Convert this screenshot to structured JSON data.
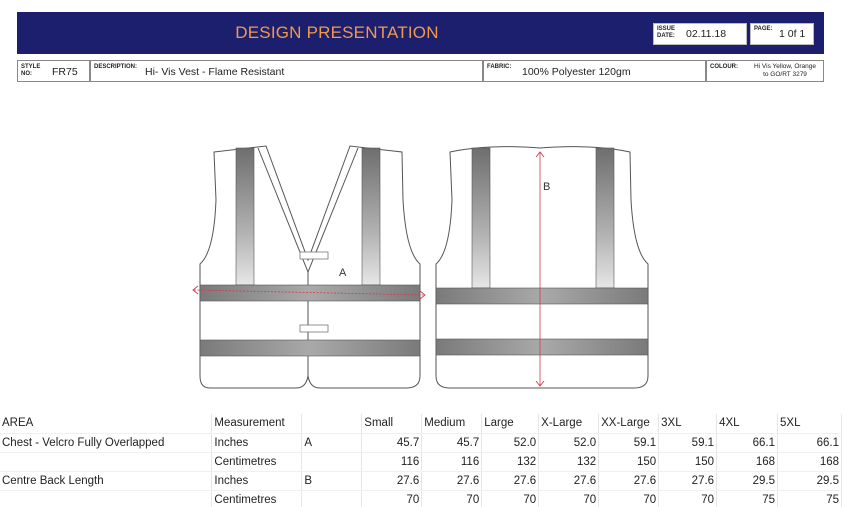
{
  "header": {
    "title": "DESIGN PRESENTATION",
    "issue_label": "ISSUE DATE:",
    "issue_date": "02.11.18",
    "page_label": "PAGE:",
    "page_value": "1 0f 1"
  },
  "info": {
    "style_label": "STYLE NO:",
    "style_value": "FR75",
    "description_label": "DESCRIPTION:",
    "description_value": "Hi- Vis Vest - Flame Resistant",
    "fabric_label": "FABRIC:",
    "fabric_value": "100% Polyester 120gm",
    "colour_label": "COLOUR:",
    "colour_value_1": "Hi Vis Yellow, Orange",
    "colour_value_2": "to GO/RT 3279"
  },
  "drawing": {
    "label_a": "A",
    "label_b": "B"
  },
  "table": {
    "header": [
      "AREA",
      "Measurement",
      "",
      "Small",
      "Medium",
      "Large",
      "X-Large",
      "XX-Large",
      "3XL",
      "4XL",
      "5XL"
    ],
    "rows": [
      [
        "Chest - Velcro Fully Overlapped",
        "Inches",
        "A",
        "45.7",
        "45.7",
        "52.0",
        "52.0",
        "59.1",
        "59.1",
        "66.1",
        "66.1"
      ],
      [
        "",
        "Centimetres",
        "",
        "116",
        "116",
        "132",
        "132",
        "150",
        "150",
        "168",
        "168"
      ],
      [
        "Centre Back Length",
        "Inches",
        "B",
        "27.6",
        "27.6",
        "27.6",
        "27.6",
        "27.6",
        "27.6",
        "29.5",
        "29.5"
      ],
      [
        "",
        "Centimetres",
        "",
        "70",
        "70",
        "70",
        "70",
        "70",
        "70",
        "75",
        "75"
      ]
    ]
  },
  "colors": {
    "header_bg": "#1c1f6e",
    "title_text": "#f2994a",
    "reflective_tape": "#8a8a8a",
    "dimension_line": "#d33a4a"
  }
}
